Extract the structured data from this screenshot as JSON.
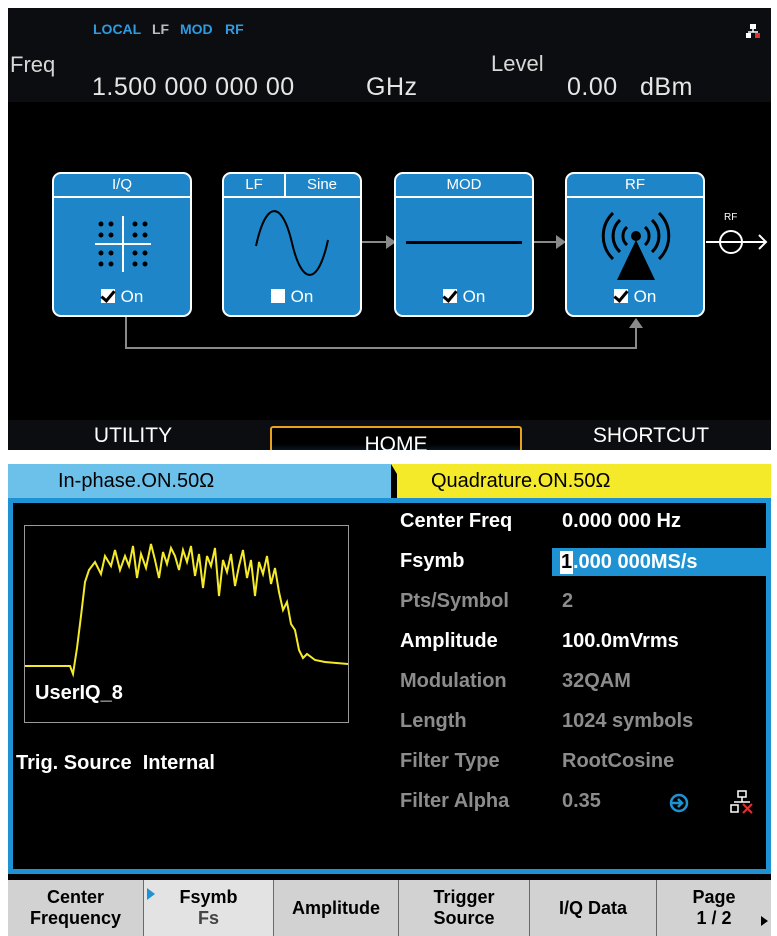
{
  "status": {
    "local": "LOCAL",
    "lf": "LF",
    "mod": "MOD",
    "rf": "RF"
  },
  "freq": {
    "label": "Freq",
    "value": "1.500 000 000 00",
    "unit": "GHz"
  },
  "level": {
    "label": "Level",
    "value": "0.00",
    "unit": "dBm"
  },
  "blocks": [
    {
      "title": "I/Q",
      "on": "On"
    },
    {
      "title": "LF",
      "wave": "Sine",
      "on": "On"
    },
    {
      "title": "MOD",
      "on": "On"
    },
    {
      "title": "RF",
      "on": "On"
    }
  ],
  "rf_out_label": "RF",
  "softkeys": [
    "UTILITY",
    "HOME",
    "SHORTCUT"
  ],
  "tabs": {
    "left": "In-phase.ON.50Ω",
    "right": "Quadrature.ON.50Ω"
  },
  "waveform_name": "UserIQ_8",
  "trigger": "Trig. Source  Internal",
  "params": [
    {
      "label": "Center Freq",
      "value": "0.000 000 Hz"
    },
    {
      "label": "Fsymb",
      "value": "1.000 000MS/s",
      "cursor": "1",
      "rest": ".000 000MS/s"
    },
    {
      "label": "Pts/Symbol",
      "value": "2"
    },
    {
      "label": "Amplitude",
      "value": "100.0mVrms"
    },
    {
      "label": "Modulation",
      "value": "32QAM"
    },
    {
      "label": "Length",
      "value": "1024 symbols"
    },
    {
      "label": "Filter Type",
      "value": "RootCosine"
    },
    {
      "label": "Filter Alpha",
      "value": "0.35"
    }
  ],
  "menu": [
    {
      "line1": "Center",
      "line2": "Frequency"
    },
    {
      "line1": "Fsymb",
      "line2": "Fs"
    },
    {
      "line1": "Amplitude",
      "line2": ""
    },
    {
      "line1": "Trigger",
      "line2": "Source"
    },
    {
      "line1": "I/Q Data",
      "line2": ""
    },
    {
      "line1": "Page",
      "line2": "1 / 2"
    }
  ],
  "colors": {
    "accent_blue": "#1e86c8",
    "tab_in_phase": "#6cc1ea",
    "tab_quadrature": "#f5ea2a",
    "trace": "#f5ea2a",
    "highlight_border": "#e9a21e"
  }
}
